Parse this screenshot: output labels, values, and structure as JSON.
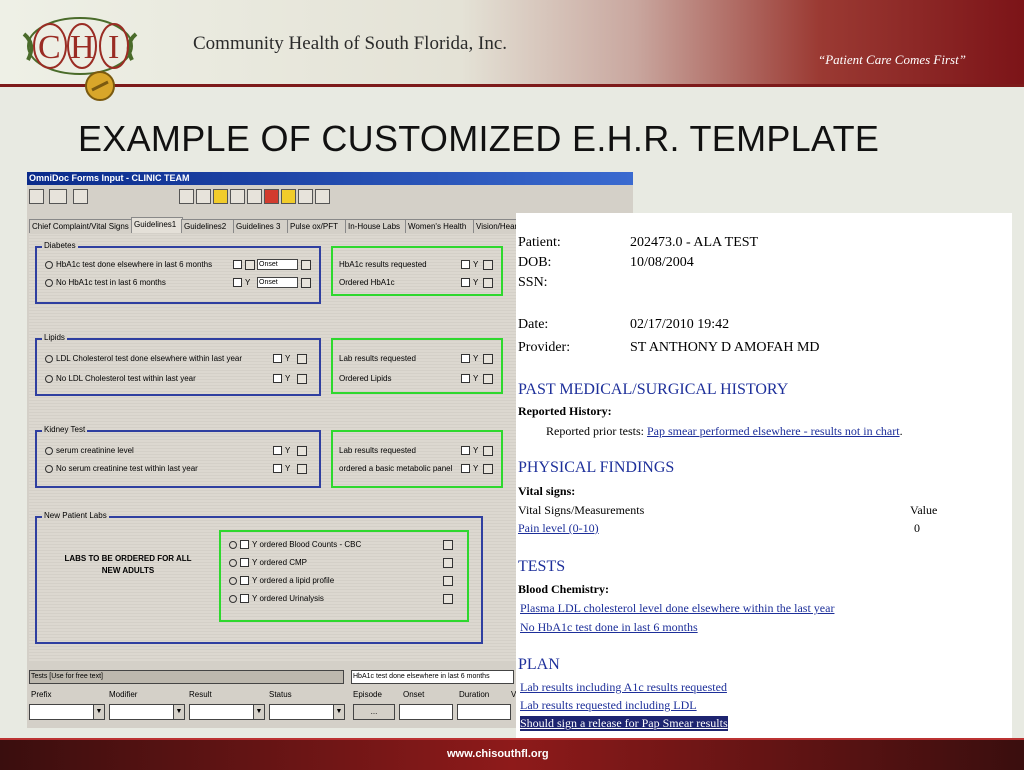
{
  "header": {
    "logo_text": "CHI",
    "organization": "Community Health of South Florida, Inc.",
    "tagline": "“Patient Care Comes First”"
  },
  "slide_title": "EXAMPLE OF CUSTOMIZED E.H.R. TEMPLATE",
  "footer": {
    "url": "www.chisouthfl.org"
  },
  "app": {
    "window_title": "OmniDoc Forms Input - CLINIC TEAM",
    "tabs": [
      "Chief Complaint/Vital Signs",
      "Guidelines1",
      "Guidelines2",
      "Guidelines 3",
      "Pulse ox/PFT",
      "In-House Labs",
      "Women's Health",
      "Vision/Hear"
    ],
    "active_tab": "Guidelines1",
    "diabetes": {
      "label": "Diabetes",
      "rows": [
        "HbA1c test done elsewhere in last 6 months",
        "No HbA1c test in last 6 months"
      ],
      "onset": "Onset",
      "right_rows": [
        "HbA1c results requested",
        "Ordered HbA1c"
      ]
    },
    "lipids": {
      "label": "Lipids",
      "rows": [
        "LDL Cholesterol test done elsewhere within last year",
        "No LDL Cholesterol test within last year"
      ],
      "right_rows": [
        "Lab results requested",
        "Ordered Lipids"
      ]
    },
    "kidney": {
      "label": "Kidney Test",
      "rows": [
        "serum creatinine level",
        "No serum creatinine test within last year"
      ],
      "right_rows": [
        "Lab results requested",
        "ordered a basic metabolic panel"
      ]
    },
    "new_patient": {
      "label": "New Patient Labs",
      "note_line1": "LABS TO BE ORDERED FOR ALL",
      "note_line2": "NEW ADULTS",
      "rows": [
        "ordered Blood Counts - CBC",
        "ordered CMP",
        "ordered a lipid profile",
        "ordered Urinalysis"
      ]
    },
    "y_label": "Y",
    "bottom": {
      "tests_label": "Tests [Use for free text]",
      "tests_value": "HbA1c test done elsewhere in last 6 months",
      "columns": [
        "Prefix",
        "Modifier",
        "Result",
        "Status",
        "Episode",
        "Onset",
        "Duration",
        "V"
      ],
      "episode_button": "..."
    }
  },
  "report": {
    "patient_label": "Patient:",
    "patient_value": "202473.0 - ALA TEST",
    "dob_label": "DOB:",
    "dob_value": "10/08/2004",
    "ssn_label": "SSN:",
    "date_label": "Date:",
    "date_value": "02/17/2010 19:42",
    "provider_label": "Provider:",
    "provider_value": "ST ANTHONY D AMOFAH MD",
    "pmh_title": "PAST MEDICAL/SURGICAL HISTORY",
    "reported_history": "Reported History:",
    "prior_tests_label": "Reported prior tests:",
    "prior_tests_link": "Pap smear performed elsewhere - results not in chart",
    "prior_tests_end": ".",
    "pf_title": "PHYSICAL FINDINGS",
    "vital_signs": "Vital signs:",
    "vs_measure_col": "Vital Signs/Measurements",
    "vs_value_col": "Value",
    "pain_link": "Pain level (0-10)",
    "pain_value": "0",
    "tests_title": "TESTS",
    "blood_chem": "Blood Chemistry:",
    "test_link1": "Plasma LDL cholesterol level done elsewhere within the last year",
    "test_link2": "No HbA1c test done in last 6 months",
    "plan_title": "PLAN",
    "plan1": "Lab results including A1c results requested",
    "plan2": "Lab results requested including LDL",
    "plan3": "Should sign a release for Pap Smear results"
  }
}
